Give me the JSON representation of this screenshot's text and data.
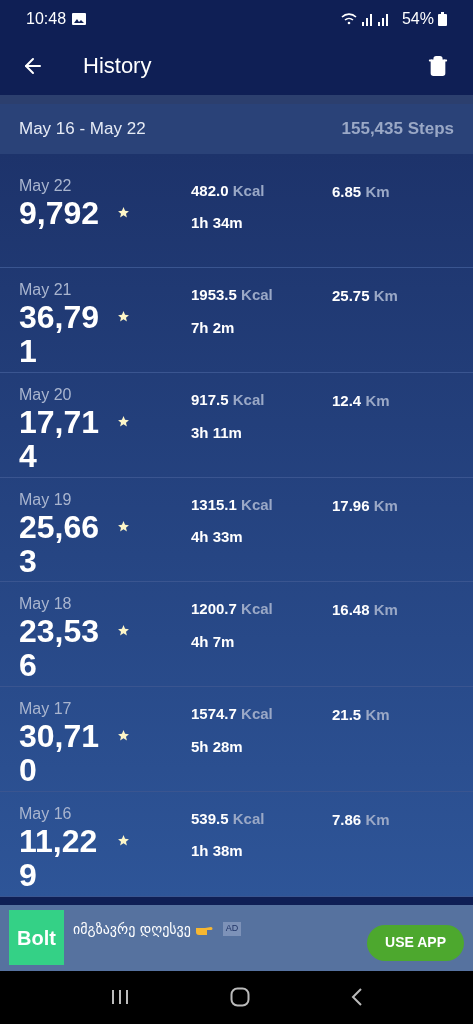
{
  "status_bar": {
    "time": "10:48",
    "battery": "54%"
  },
  "app_bar": {
    "title": "History"
  },
  "week": {
    "range": "May 16 - May 22",
    "total": "155,435 Steps"
  },
  "days": [
    {
      "date": "May 22",
      "steps": "9,792",
      "kcal": "482.0",
      "kcal_unit": "Kcal",
      "duration": "1h 34m",
      "distance": "6.85",
      "distance_unit": "Km"
    },
    {
      "date": "May 21",
      "steps": "36,791",
      "kcal": "1953.5",
      "kcal_unit": "Kcal",
      "duration": "7h 2m",
      "distance": "25.75",
      "distance_unit": "Km"
    },
    {
      "date": "May 20",
      "steps": "17,714",
      "kcal": "917.5",
      "kcal_unit": "Kcal",
      "duration": "3h 11m",
      "distance": "12.4",
      "distance_unit": "Km"
    },
    {
      "date": "May 19",
      "steps": "25,663",
      "kcal": "1315.1",
      "kcal_unit": "Kcal",
      "duration": "4h 33m",
      "distance": "17.96",
      "distance_unit": "Km"
    },
    {
      "date": "May 18",
      "steps": "23,536",
      "kcal": "1200.7",
      "kcal_unit": "Kcal",
      "duration": "4h 7m",
      "distance": "16.48",
      "distance_unit": "Km"
    },
    {
      "date": "May 17",
      "steps": "30,710",
      "kcal": "1574.7",
      "kcal_unit": "Kcal",
      "duration": "5h 28m",
      "distance": "21.5",
      "distance_unit": "Km"
    },
    {
      "date": "May 16",
      "steps": "11,229",
      "kcal": "539.5",
      "kcal_unit": "Kcal",
      "duration": "1h 38m",
      "distance": "7.86",
      "distance_unit": "Km"
    }
  ],
  "ad": {
    "logo": "Bolt",
    "text": "იმგზავრე დღესვე",
    "badge": "AD",
    "button": "USE APP"
  }
}
